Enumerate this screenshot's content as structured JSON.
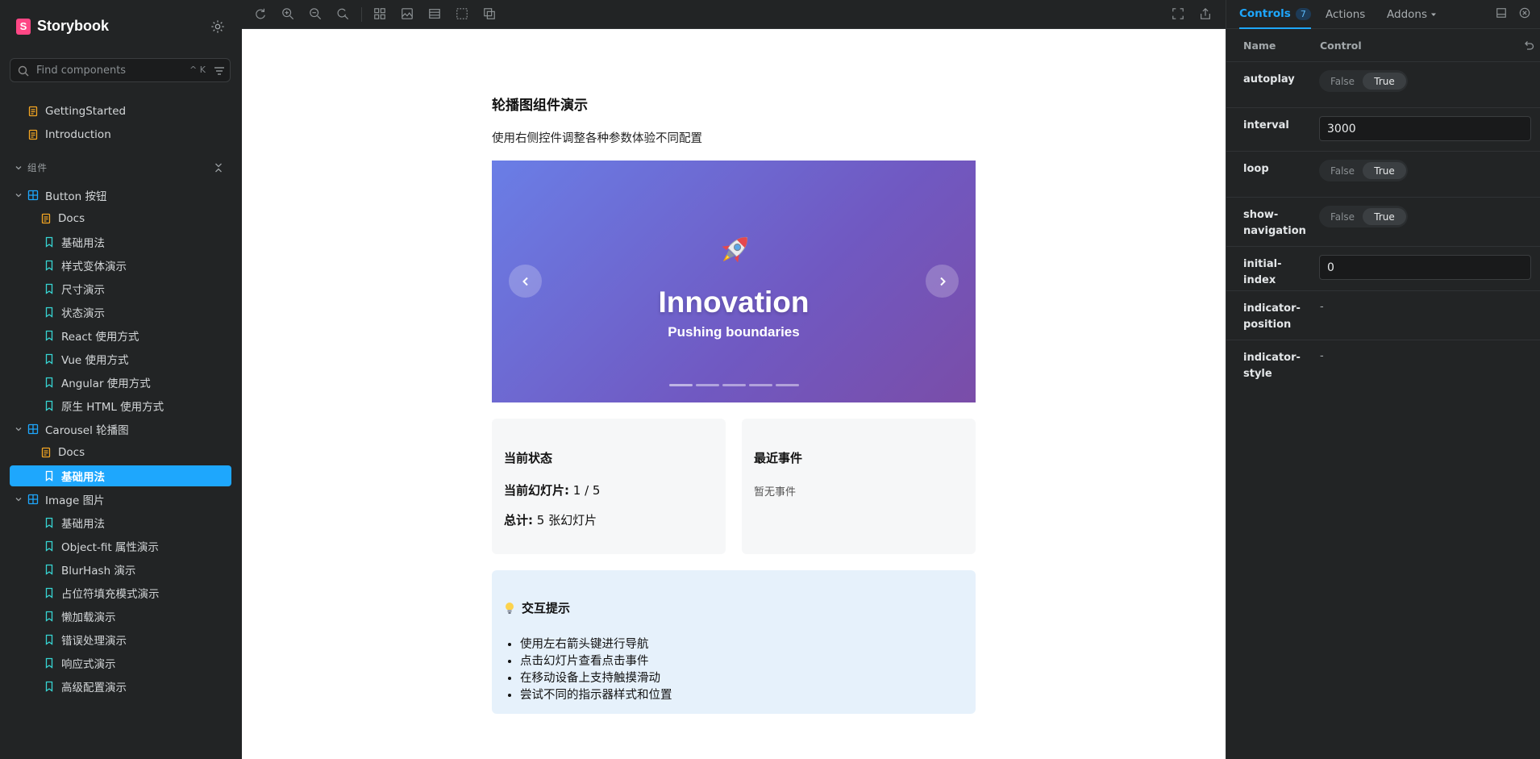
{
  "sidebar": {
    "brand": "Storybook",
    "brand_logo": "S",
    "search": {
      "placeholder": "Find components",
      "shortcut": "^ K"
    },
    "top_items": [
      {
        "label": "GettingStarted",
        "icon": "doc-icon"
      },
      {
        "label": "Introduction",
        "icon": "doc-icon"
      }
    ],
    "section": {
      "label": "组件"
    },
    "groups": [
      {
        "label": "Button 按钮",
        "items": [
          "Docs",
          "基础用法",
          "样式变体演示",
          "尺寸演示",
          "状态演示",
          "React 使用方式",
          "Vue 使用方式",
          "Angular 使用方式",
          "原生 HTML 使用方式"
        ]
      },
      {
        "label": "Carousel 轮播图",
        "items": [
          "Docs",
          "基础用法"
        ],
        "selected": "基础用法"
      },
      {
        "label": "Image 图片",
        "items": [
          "基础用法",
          "Object-fit 属性演示",
          "BlurHash 演示",
          "占位符填充模式演示",
          "懒加载演示",
          "错误处理演示",
          "响应式演示",
          "高级配置演示"
        ]
      }
    ]
  },
  "canvas": {
    "title": "轮播图组件演示",
    "subtitle": "使用右侧控件调整各种参数体验不同配置",
    "slide": {
      "emoji": "rocket-icon",
      "title": "Innovation",
      "subtitle": "Pushing boundaries",
      "count": 5,
      "active_index": 0
    },
    "state_card": {
      "title": "当前状态",
      "current_label": "当前幻灯片:",
      "current_value": "1 / 5",
      "total_label": "总计:",
      "total_value": "5 张幻灯片"
    },
    "events_card": {
      "title": "最近事件",
      "empty": "暂无事件"
    },
    "tips": {
      "title": "交互提示",
      "items": [
        "使用左右箭头键进行导航",
        "点击幻灯片查看点击事件",
        "在移动设备上支持触摸滑动",
        "尝试不同的指示器样式和位置"
      ]
    }
  },
  "panel": {
    "tabs": [
      {
        "label": "Controls",
        "count": "7"
      },
      {
        "label": "Actions"
      },
      {
        "label": "Addons"
      }
    ],
    "header": {
      "name": "Name",
      "control": "Control"
    },
    "controls": [
      {
        "name": "autoplay",
        "type": "boolean",
        "value": "True"
      },
      {
        "name": "interval",
        "type": "text",
        "value": "3000"
      },
      {
        "name": "loop",
        "type": "boolean",
        "value": "True"
      },
      {
        "name": "show-navigation",
        "type": "boolean",
        "value": "True"
      },
      {
        "name": "initial-index",
        "type": "text",
        "value": "0"
      },
      {
        "name": "indicator-position",
        "type": "none",
        "value": "-"
      },
      {
        "name": "indicator-style",
        "type": "none",
        "value": "-"
      }
    ],
    "toggle_labels": {
      "false": "False",
      "true": "True"
    }
  },
  "colors": {
    "accent": "#1ea7fd",
    "brand": "#ff4785",
    "slide_from": "#6a7ee6",
    "slide_to": "#7a4da8"
  }
}
